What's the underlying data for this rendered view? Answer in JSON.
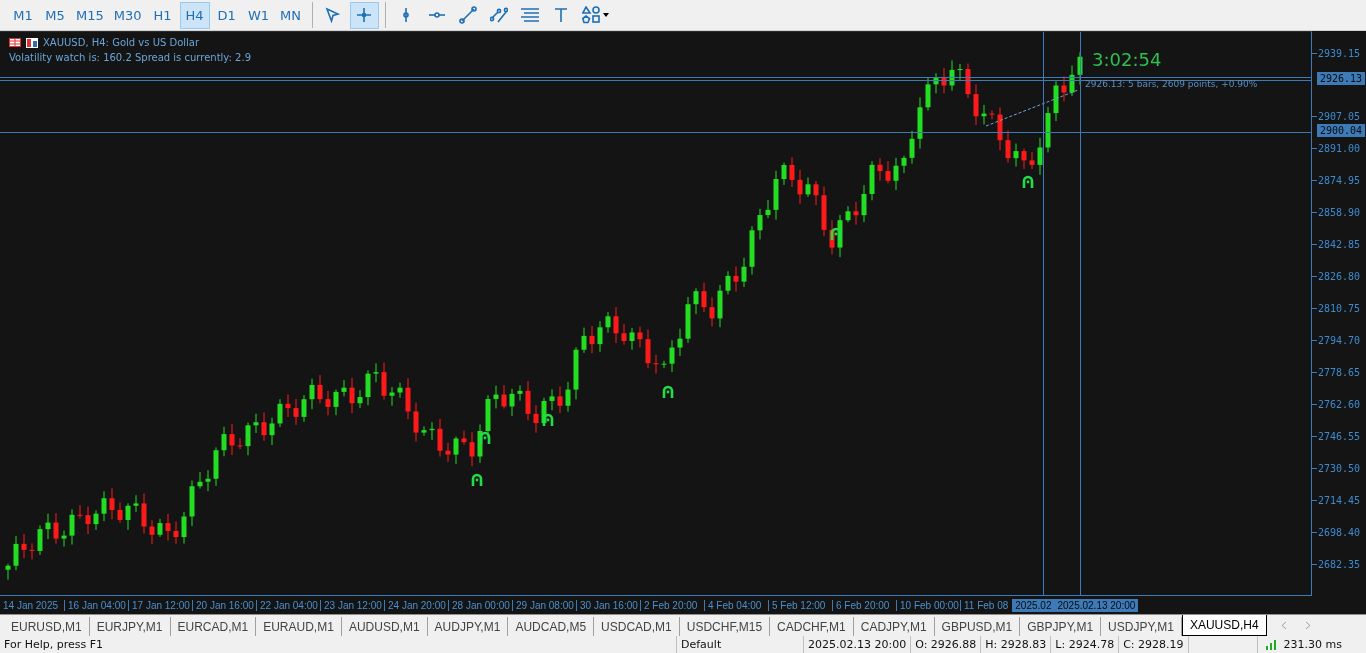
{
  "toolbar": {
    "timeframes": [
      {
        "label": "M1",
        "selected": false
      },
      {
        "label": "M5",
        "selected": false
      },
      {
        "label": "M15",
        "selected": false
      },
      {
        "label": "M30",
        "selected": false
      },
      {
        "label": "H1",
        "selected": false
      },
      {
        "label": "H4",
        "selected": true
      },
      {
        "label": "D1",
        "selected": false
      },
      {
        "label": "W1",
        "selected": false
      },
      {
        "label": "MN",
        "selected": false
      }
    ],
    "tools": [
      {
        "kind": "cursor",
        "selected": false
      },
      {
        "kind": "crosshair",
        "selected": true
      },
      {
        "kind": "vline",
        "selected": false
      },
      {
        "kind": "hline",
        "selected": false
      },
      {
        "kind": "trend",
        "selected": false
      },
      {
        "kind": "channel",
        "selected": false
      },
      {
        "kind": "lines",
        "selected": false
      },
      {
        "kind": "text",
        "selected": false
      },
      {
        "kind": "shapes",
        "selected": false
      }
    ]
  },
  "chart": {
    "title": "XAUUSD, H4:  Gold vs US Dollar",
    "info": "Volatility watch is: 160.2 Spread is currently: 2.9",
    "countdown": "3:02:54",
    "measure_label": "2926.13: 5 bars, 2609 points, +0.90%",
    "price_axis": [
      "2939.15",
      "2907.05",
      "2891.00",
      "2874.95",
      "2858.90",
      "2842.85",
      "2826.80",
      "2810.75",
      "2794.70",
      "2778.65",
      "2762.60",
      "2746.55",
      "2730.50",
      "2714.45",
      "2698.40",
      "2682.35"
    ],
    "price_markers": [
      "2926.13",
      "2900.04"
    ],
    "time_axis": [
      "14 Jan 2025",
      "16 Jan 04:00",
      "17 Jan 12:00",
      "20 Jan 16:00",
      "22 Jan 04:00",
      "23 Jan 12:00",
      "24 Jan 20:00",
      "28 Jan 00:00",
      "29 Jan 08:00",
      "30 Jan 16:00",
      "2 Feb 20:00",
      "4 Feb 04:00",
      "5 Feb 12:00",
      "6 Feb 20:00",
      "10 Feb 00:00",
      "11 Feb 08"
    ],
    "time_markers": [
      "2025.02",
      "2025.02.13 20:00"
    ]
  },
  "symbol_tabs": [
    {
      "label": "EURUSD,M1",
      "selected": false
    },
    {
      "label": "EURJPY,M1",
      "selected": false
    },
    {
      "label": "EURCAD,M1",
      "selected": false
    },
    {
      "label": "EURAUD,M1",
      "selected": false
    },
    {
      "label": "AUDUSD,M1",
      "selected": false
    },
    {
      "label": "AUDJPY,M1",
      "selected": false
    },
    {
      "label": "AUDCAD,M5",
      "selected": false
    },
    {
      "label": "USDCAD,M1",
      "selected": false
    },
    {
      "label": "USDCHF,M15",
      "selected": false
    },
    {
      "label": "CADCHF,M1",
      "selected": false
    },
    {
      "label": "CADJPY,M1",
      "selected": false
    },
    {
      "label": "GBPUSD,M1",
      "selected": false
    },
    {
      "label": "GBPJPY,M1",
      "selected": false
    },
    {
      "label": "USDJPY,M1",
      "selected": false
    },
    {
      "label": "XAUUSD,H4",
      "selected": true
    }
  ],
  "status_bar": {
    "help": "For Help, press F1",
    "profile": "Default",
    "time": "2025.02.13 20:00",
    "open": "O: 2926.88",
    "high": "H: 2928.83",
    "low": "L: 2924.78",
    "close": "C: 2928.19",
    "ping": "231.30 ms"
  }
}
